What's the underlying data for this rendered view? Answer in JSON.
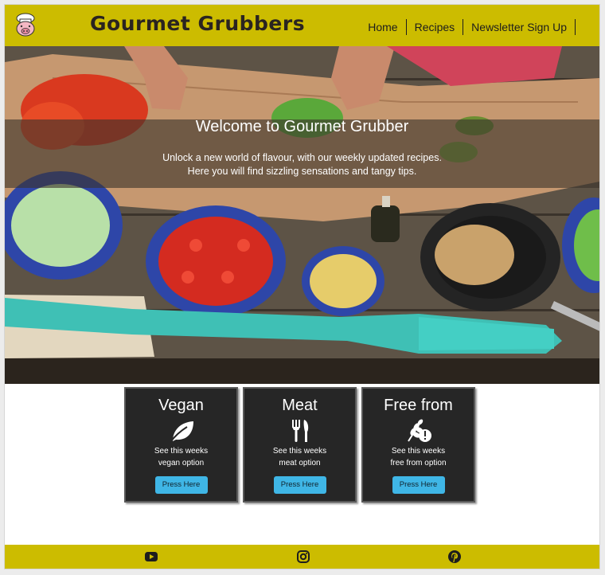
{
  "header": {
    "brand": "Gourmet Grubbers",
    "nav": [
      "Home",
      "Recipes",
      "Newsletter Sign Up"
    ]
  },
  "hero": {
    "title": "Welcome to Gourmet Grubber",
    "line1": "Unlock a new world of flavour, with our weekly updated recipes.",
    "line2": "Here you will find sizzling sensations and tangy tips."
  },
  "cards": [
    {
      "title": "Vegan",
      "line1": "See this weeks",
      "line2": "vegan option",
      "button": "Press Here",
      "icon": "leaf-icon"
    },
    {
      "title": "Meat",
      "line1": "See this weeks",
      "line2": "meat option",
      "button": "Press Here",
      "icon": "utensils-icon"
    },
    {
      "title": "Free from",
      "line1": "See this weeks",
      "line2": "free from option",
      "button": "Press Here",
      "icon": "wheat-alert-icon"
    }
  ],
  "footer": {
    "icons": [
      "youtube-icon",
      "instagram-icon",
      "pinterest-icon"
    ]
  },
  "colors": {
    "header_bg": "#ccbc00",
    "card_bg": "#262626",
    "button_bg": "#3fb6e6"
  }
}
